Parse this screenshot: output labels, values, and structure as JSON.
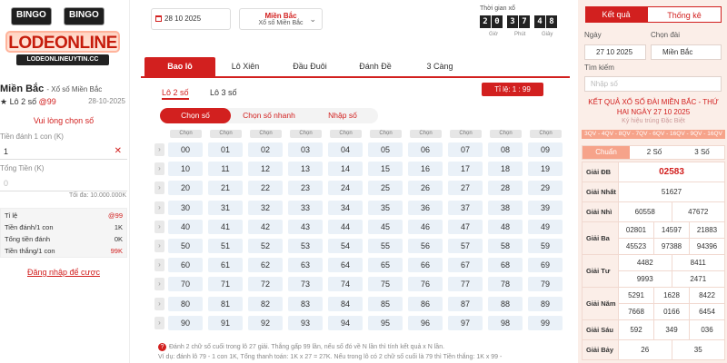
{
  "logo": {
    "bingo_left": "BINGO",
    "bingo_right": "BINGO",
    "main": "LODEONLINE",
    "sub": "LODEONLINEUYTIN.CC"
  },
  "left": {
    "region": "Miền Bắc",
    "region_sub": "- Xổ số Miền Bắc",
    "game_prefix": "★ Lô 2 số",
    "game_odds": "@99",
    "date": "28-10-2025",
    "choose_hint": "Vui lòng chọn số",
    "stake_label": "Tiền đánh 1 con (K)",
    "stake_value": "1",
    "total_label": "Tổng Tiền (K)",
    "total_placeholder": "0",
    "max_text": "Tối đa: 10.000.000K",
    "stats": [
      {
        "label": "Tỉ lệ",
        "value": "@99"
      },
      {
        "label": "Tiền đánh/1 con",
        "value": "1K"
      },
      {
        "label": "Tổng tiền đánh",
        "value": "0K"
      },
      {
        "label": "Tiền thắng/1 con",
        "value": "99K"
      }
    ],
    "login": "Đăng nhập để cược"
  },
  "header": {
    "date": "28 10 2025",
    "region": "Miền Bắc",
    "region_sub": "Xổ số Miền Bắc",
    "timer_label": "Thời gian xổ",
    "timer_digits": [
      "2",
      "0",
      "3",
      "7",
      "4",
      "8"
    ],
    "timer_units": [
      "Giờ",
      "Phút",
      "Giây"
    ]
  },
  "tabs": [
    "Bao lô",
    "Lô Xiên",
    "Đầu Đuôi",
    "Đánh Đề",
    "3 Càng"
  ],
  "subtabs": [
    "Lô 2 số",
    "Lô 3 số"
  ],
  "odds": "Tỉ lệ: 1 : 99",
  "segments": [
    "Chọn số",
    "Chọn số nhanh",
    "Nhập số"
  ],
  "grid": {
    "col_headers": [
      "Chọn",
      "Chọn",
      "Chọn",
      "Chọn",
      "Chọn",
      "Chọn",
      "Chọn",
      "Chọn",
      "Chọn",
      "Chọn"
    ],
    "rows": [
      [
        "00",
        "01",
        "02",
        "03",
        "04",
        "05",
        "06",
        "07",
        "08",
        "09"
      ],
      [
        "10",
        "11",
        "12",
        "13",
        "14",
        "15",
        "16",
        "17",
        "18",
        "19"
      ],
      [
        "20",
        "21",
        "22",
        "23",
        "24",
        "25",
        "26",
        "27",
        "28",
        "29"
      ],
      [
        "30",
        "31",
        "32",
        "33",
        "34",
        "35",
        "36",
        "37",
        "38",
        "39"
      ],
      [
        "40",
        "41",
        "42",
        "43",
        "44",
        "45",
        "46",
        "47",
        "48",
        "49"
      ],
      [
        "50",
        "51",
        "52",
        "53",
        "54",
        "55",
        "56",
        "57",
        "58",
        "59"
      ],
      [
        "60",
        "61",
        "62",
        "63",
        "64",
        "65",
        "66",
        "67",
        "68",
        "69"
      ],
      [
        "70",
        "71",
        "72",
        "73",
        "74",
        "75",
        "76",
        "77",
        "78",
        "79"
      ],
      [
        "80",
        "81",
        "82",
        "83",
        "84",
        "85",
        "86",
        "87",
        "88",
        "89"
      ],
      [
        "90",
        "91",
        "92",
        "93",
        "94",
        "95",
        "96",
        "97",
        "98",
        "99"
      ]
    ]
  },
  "note": {
    "line1": "Đánh 2 chữ số cuối trong lô 27 giải. Thắng gấp 99 lần, nếu số đó về N lần thì tính kết quả x N lần.",
    "line2": "Ví dụ: đánh lô 79 - 1 con 1K, Tổng thanh toán: 1K x 27 = 27K. Nếu trong lô có 2 chữ số cuối là 79 thì Tiền thắng: 1K x 99 -"
  },
  "right": {
    "tab_result": "Kết quả",
    "tab_stats": "Thống kê",
    "date_label": "Ngày",
    "region_label": "Chọn đài",
    "date_value": "27 10 2025",
    "region_value": "Miền Bắc",
    "search_label": "Tìm kiếm",
    "search_placeholder": "Nhập số",
    "result_title": "KẾT QUẢ XỔ SỐ ĐÀI MIỀN BẮC - THỨ HAI NGÀY 27 10 2025",
    "result_sub": "Ký hiệu trúng Đặc Biệt",
    "result_codes": "3QV - 4QV - 8QV - 7QV - 6QV - 16QV - 9QV - 16QV",
    "segments": [
      "Chuẩn",
      "2 Số",
      "3 Số"
    ],
    "prizes": [
      {
        "name": "Giải ĐB",
        "values": [
          "02583"
        ]
      },
      {
        "name": "Giải Nhất",
        "values": [
          "51627"
        ]
      },
      {
        "name": "Giải Nhì",
        "values": [
          "60558",
          "47672"
        ]
      },
      {
        "name": "Giải Ba",
        "values": [
          "02801",
          "14597",
          "21883",
          "45523",
          "97388",
          "94396"
        ]
      },
      {
        "name": "Giải Tư",
        "values": [
          "4482",
          "8411",
          "9993",
          "2471"
        ]
      },
      {
        "name": "Giải Năm",
        "values": [
          "5291",
          "1628",
          "8422",
          "7668",
          "0166",
          "6454"
        ]
      },
      {
        "name": "Giải Sáu",
        "values": [
          "592",
          "349",
          "036"
        ]
      },
      {
        "name": "Giải Bảy",
        "values": [
          "26",
          "35"
        ]
      }
    ]
  }
}
